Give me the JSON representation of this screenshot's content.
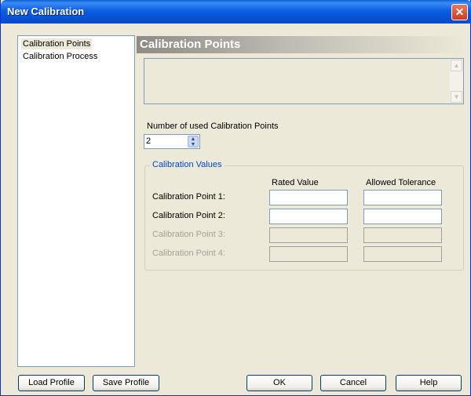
{
  "window": {
    "title": "New Calibration",
    "close_glyph": "✕"
  },
  "nav": {
    "items": [
      "Calibration Points",
      "Calibration Process"
    ],
    "selected_index": 0
  },
  "section": {
    "title": "Calibration Points",
    "description": ""
  },
  "points_count": {
    "label": "Number of used Calibration Points",
    "value": "2"
  },
  "calibration_values": {
    "group_title": "Calibration Values",
    "col_rated": "Rated Value",
    "col_tolerance": "Allowed Tolerance",
    "rows": [
      {
        "label": "Calibration Point 1:",
        "rated": "",
        "tolerance": "",
        "enabled": true
      },
      {
        "label": "Calibration Point 2:",
        "rated": "",
        "tolerance": "",
        "enabled": true
      },
      {
        "label": "Calibration Point 3:",
        "rated": "",
        "tolerance": "",
        "enabled": false
      },
      {
        "label": "Calibration Point 4:",
        "rated": "",
        "tolerance": "",
        "enabled": false
      }
    ]
  },
  "buttons": {
    "load_profile": "Load Profile",
    "save_profile": "Save Profile",
    "ok": "OK",
    "cancel": "Cancel",
    "help": "Help"
  },
  "icons": {
    "close": "close-icon",
    "scroll_up": "scroll-up-arrow-icon",
    "scroll_down": "scroll-down-arrow-icon",
    "spin_up": "spin-up-arrow-icon",
    "spin_down": "spin-down-arrow-icon"
  },
  "colors": {
    "titlebar": "#0a5fd6",
    "group_title": "#0046d5",
    "dialog_bg": "#ece9d8"
  }
}
